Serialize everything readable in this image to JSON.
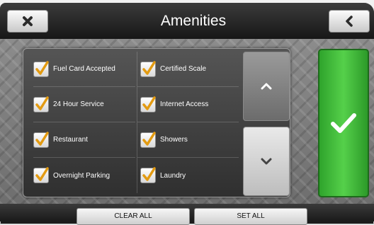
{
  "header": {
    "title": "Amenities",
    "close_icon": "close-x-icon",
    "back_icon": "chevron-left-icon"
  },
  "amenities": {
    "col1": [
      "Fuel Card Accepted",
      "24 Hour Service",
      "Restaurant",
      "Overnight Parking"
    ],
    "col2": [
      "Certified Scale",
      "Internet Access",
      "Showers",
      "Laundry"
    ]
  },
  "footer": {
    "clear_all": "CLEAR ALL",
    "set_all": "SET ALL"
  },
  "colors": {
    "accent": "#e0a31e",
    "confirm": "#3cbf35",
    "check": "#e39b12"
  }
}
